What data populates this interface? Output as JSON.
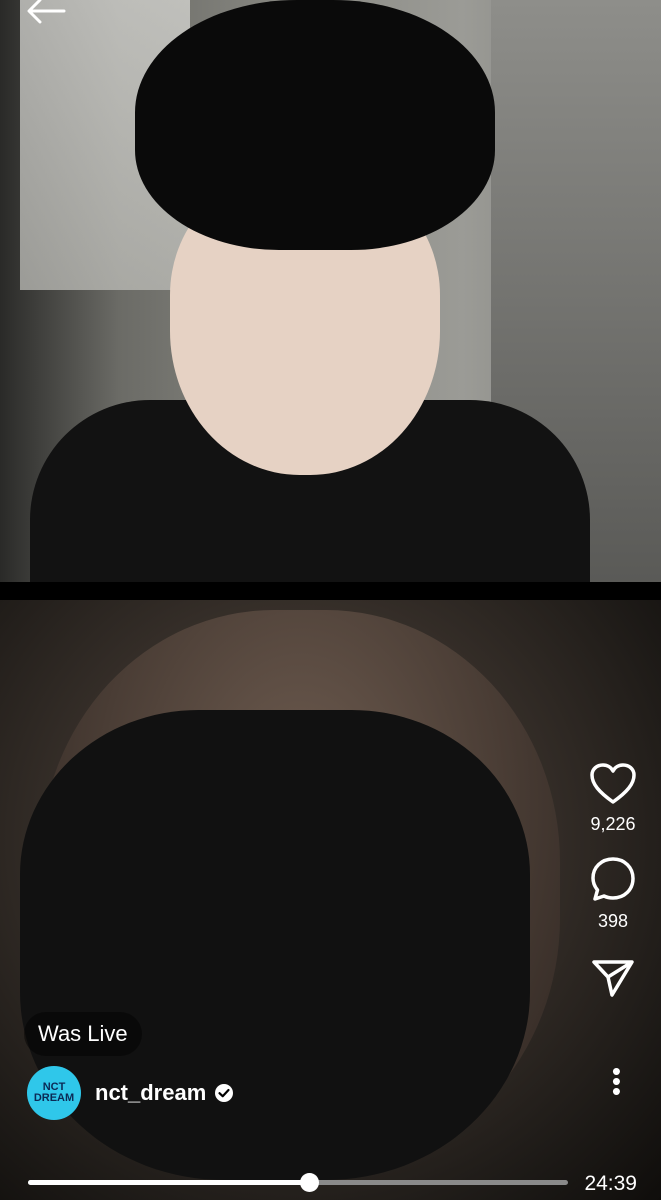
{
  "live": {
    "status": "Was Live",
    "username": "nct_dream",
    "avatar_text": "NCT DREAM",
    "verified": true
  },
  "actions": {
    "likes": "9,226",
    "comments": "398"
  },
  "player": {
    "time": "24:39",
    "progress": 0.52
  },
  "icons": [
    "back-arrow-icon",
    "heart-icon",
    "comment-icon",
    "send-icon",
    "more-icon",
    "verified-icon"
  ],
  "colors": {
    "accent": "#ffffff",
    "avatar_bg": "#2fc7ea"
  }
}
